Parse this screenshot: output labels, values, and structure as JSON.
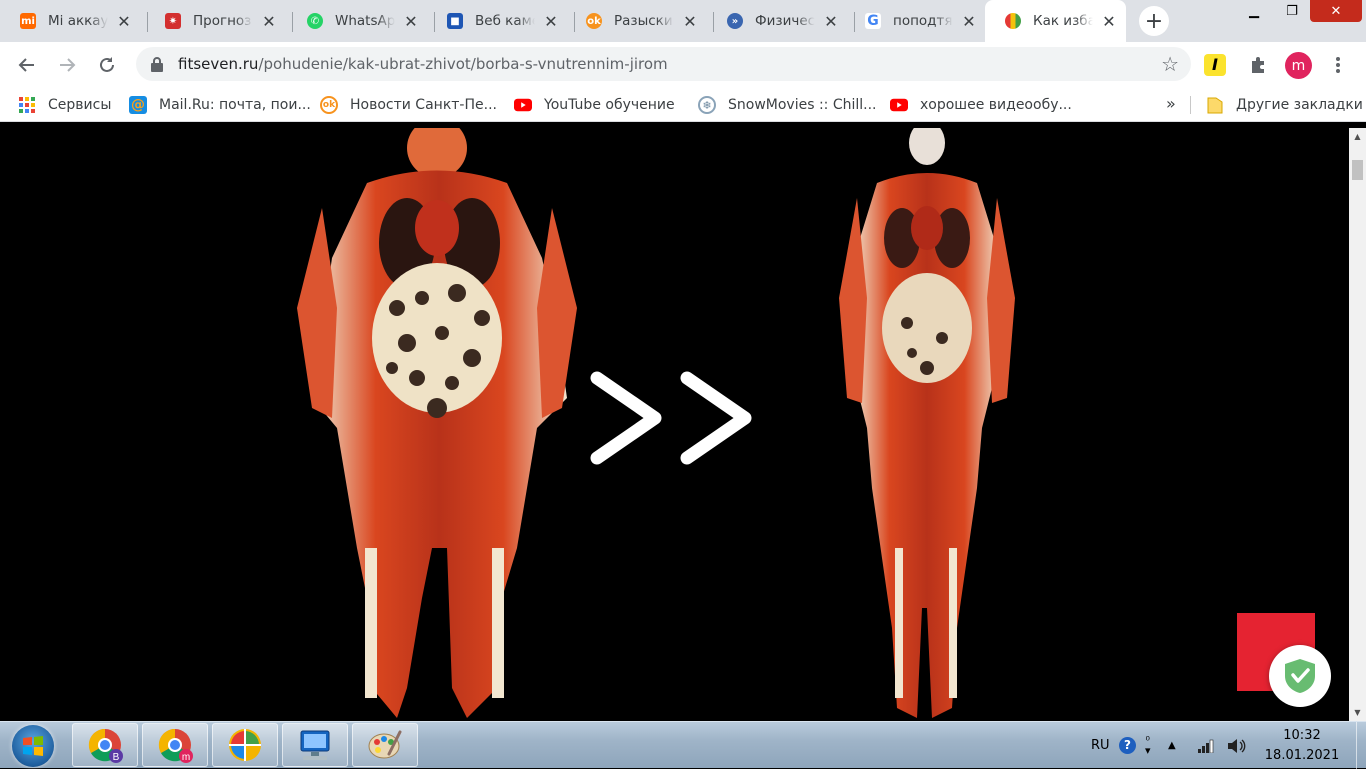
{
  "tabs": [
    {
      "title": "Mi аккаунт",
      "icon": "xiaomi-icon",
      "color": "#ff6900"
    },
    {
      "title": "Прогноз",
      "icon": "forecast-icon",
      "color": "#d32f2f"
    },
    {
      "title": "WhatsApp",
      "icon": "whatsapp-icon",
      "color": "#25d366"
    },
    {
      "title": "Веб камеры",
      "icon": "webcam-icon",
      "color": "#1e56b4"
    },
    {
      "title": "Разыскиваются",
      "icon": "odnoklassniki-icon",
      "color": "#f7931e"
    },
    {
      "title": "Физические",
      "icon": "physics-icon",
      "color": "#3a66b0"
    },
    {
      "title": "поподтянуть",
      "icon": "google-icon",
      "color": "#4285f4"
    },
    {
      "title": "Как избавиться",
      "icon": "fitseven-icon",
      "color": "#f4c20d"
    }
  ],
  "window_controls": {
    "minimize": "▁",
    "maximize": "❐",
    "close": "✕"
  },
  "toolbar": {
    "url_domain": "fitseven.ru",
    "url_path": "/pohudenie/kak-ubrat-zhivot/borba-s-vnutrennim-jirom",
    "avatar_letter": "m"
  },
  "bookmarks": {
    "items": [
      {
        "label": "Сервисы",
        "icon": "apps-grid-icon"
      },
      {
        "label": "Mail.Ru: почта, пои...",
        "icon": "mailru-icon"
      },
      {
        "label": "Новости Санкт-Пе...",
        "icon": "odnoklassniki-icon"
      },
      {
        "label": "YouTube обучение",
        "icon": "youtube-icon"
      },
      {
        "label": "SnowMovies :: Chill...",
        "icon": "snowmovies-icon"
      },
      {
        "label": "хорошее видеообу...",
        "icon": "youtube-icon"
      }
    ],
    "more": "»",
    "other_label": "Другие закладки"
  },
  "content": {
    "image_alt": "",
    "arrows": "»"
  },
  "taskbar": {
    "items": [
      "chrome-profile-b",
      "chrome-profile-m",
      "windows-live-icon",
      "remote-desktop-icon",
      "paint-icon"
    ],
    "badge_b": "B",
    "badge_m": "m",
    "lang": "RU",
    "time": "10:32",
    "date": "18.01.2021"
  },
  "colors": {
    "tab_bg": "#dee1e6",
    "active_tab": "#ffffff",
    "accent_red": "#e52331",
    "avatar": "#e0245e"
  }
}
